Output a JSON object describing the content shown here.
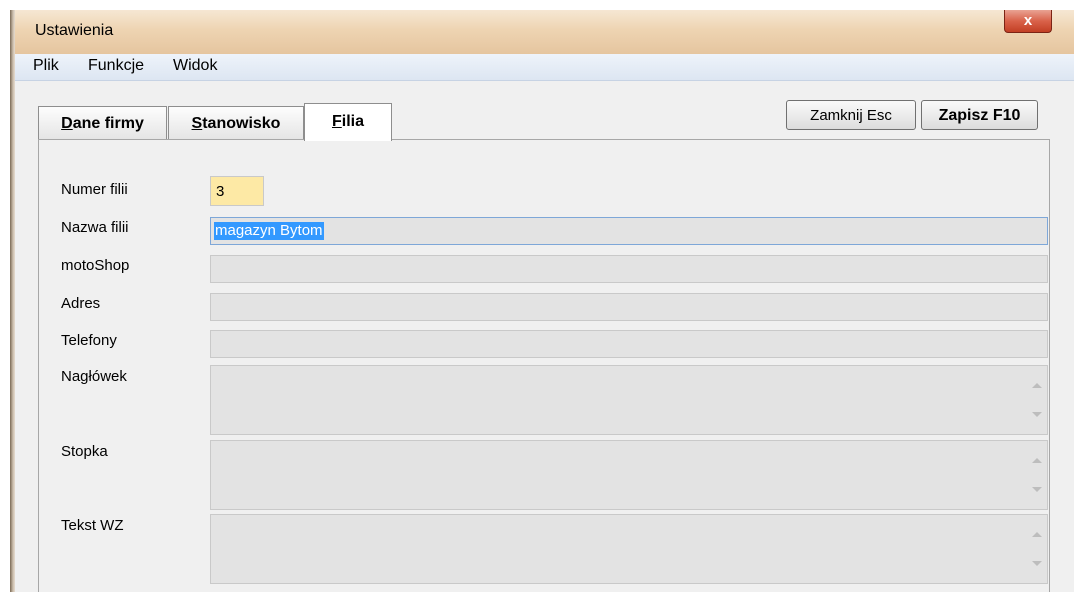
{
  "window": {
    "title": "Ustawienia",
    "close_glyph": "x"
  },
  "menu": [
    "Plik",
    "Funkcje",
    "Widok"
  ],
  "tabs": [
    {
      "mnemonic": "D",
      "rest": "ane firmy"
    },
    {
      "mnemonic": "S",
      "rest": "tanowisko"
    },
    {
      "mnemonic": "F",
      "rest": "ilia"
    }
  ],
  "active_tab": "Filia",
  "buttons": {
    "close": "Zamknij Esc",
    "save": "Zapisz F10"
  },
  "form": {
    "numer_filii": {
      "label": "Numer filii",
      "value": "3"
    },
    "nazwa_filii": {
      "label": "Nazwa filii",
      "value": "magazyn Bytom"
    },
    "motoshop": {
      "label": "motoShop",
      "value": ""
    },
    "adres": {
      "label": "Adres",
      "value": ""
    },
    "telefony": {
      "label": "Telefony",
      "value": ""
    },
    "naglowek": {
      "label": "Nagłówek",
      "value": ""
    },
    "stopka": {
      "label": "Stopka",
      "value": ""
    },
    "tekst_wz": {
      "label": "Tekst WZ",
      "value": ""
    }
  },
  "colors": {
    "number_field_bg": "#fde9a5",
    "selection": "#3399ff",
    "field_bg": "#e3e3e3"
  }
}
